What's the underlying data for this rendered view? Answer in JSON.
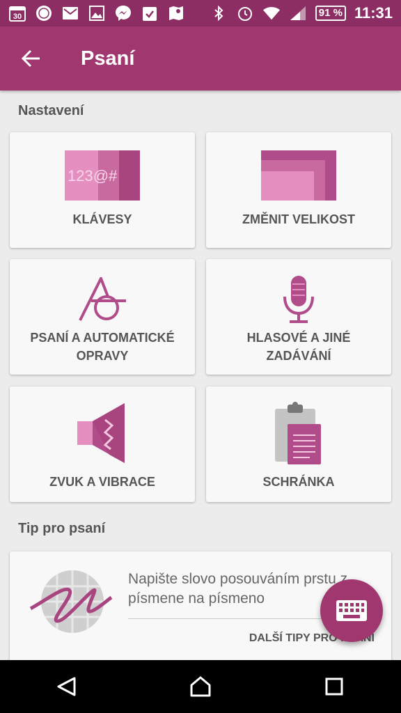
{
  "status_bar": {
    "calendar_day": "30",
    "battery": "91 %",
    "time": "11:31"
  },
  "app_bar": {
    "title": "Psaní"
  },
  "settings": {
    "heading": "Nastavení",
    "tiles": [
      {
        "label": "KLÁVESY",
        "art_text": "123@#"
      },
      {
        "label": "ZMĚNIT VELIKOST"
      },
      {
        "label": "PSANÍ A AUTOMATICKÉ OPRAVY"
      },
      {
        "label": "HLASOVÉ A JINÉ ZADÁVÁNÍ"
      },
      {
        "label": "ZVUK A VIBRACE"
      },
      {
        "label": "SCHRÁNKA"
      }
    ]
  },
  "tip": {
    "heading": "Tip pro psaní",
    "text": "Napište slovo posouváním prstu z písmene na písmeno",
    "link": "DALŠÍ TIPY PRO PSANÍ"
  },
  "colors": {
    "accent": "#a0386f",
    "status": "#8c2e63",
    "pink_light": "#e58fc0",
    "pink_mid": "#c86aa0",
    "pink_dark": "#a84480"
  }
}
